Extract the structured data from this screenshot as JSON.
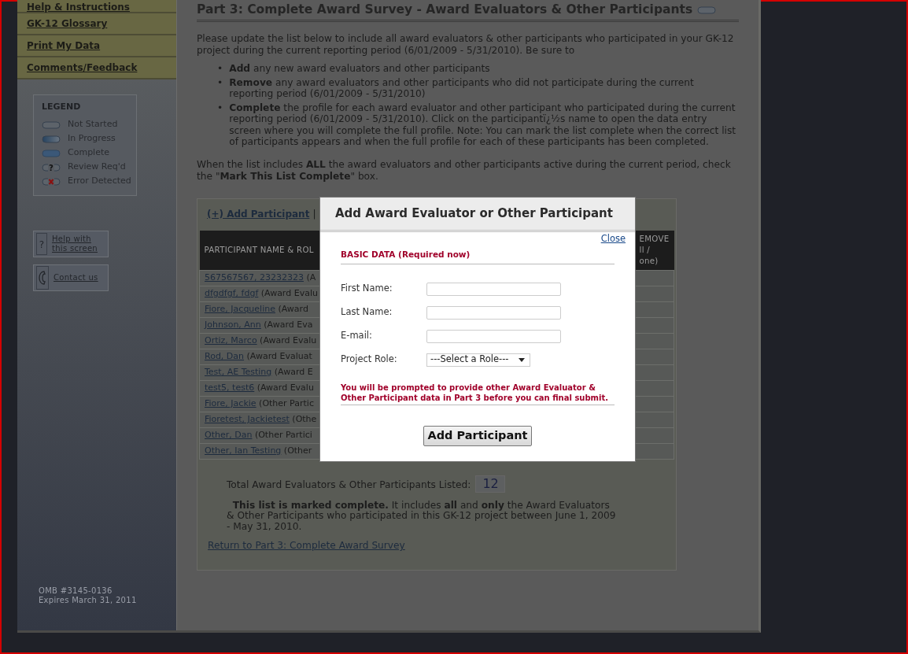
{
  "sidebar": {
    "nav_items": [
      "Help & Instructions",
      "GK-12 Glossary",
      "Print My Data",
      "Comments/Feedback"
    ],
    "legend": {
      "title": "LEGEND",
      "items": [
        {
          "kind": "not_started",
          "label": "Not Started"
        },
        {
          "kind": "in_progress",
          "label": "In Progress"
        },
        {
          "kind": "complete",
          "label": "Complete"
        },
        {
          "kind": "review",
          "label": "Review Req'd",
          "symbol": "?"
        },
        {
          "kind": "error",
          "label": "Error Detected"
        }
      ]
    },
    "help_buttons": [
      {
        "kind": "help",
        "label": "Help with this screen",
        "symbol": "?"
      },
      {
        "kind": "contact",
        "label": "Contact us"
      }
    ],
    "footer": [
      "OMB #3145-0136",
      "Expires March 31, 2011"
    ]
  },
  "page": {
    "title": "Part 3: Complete Award Survey - Award Evaluators & Other Participants",
    "intro": "Please update the list below to include all award evaluators & other participants who participated in your GK-12 project during the current reporting period (6/01/2009 - 5/31/2010). Be sure to",
    "bullets": [
      {
        "marker": "•",
        "text": "**Add** any new award evaluators and other participants"
      },
      {
        "marker": "•",
        "text": "**Remove** any award evaluators and other participants who did not participate during the current reporting period (6/01/2009 - 5/31/2010)"
      },
      {
        "marker": "•",
        "text": "**Complete** the profile for each award evaluator and other participant who participated during the current reporting period (6/01/2009 - 5/31/2010). Click on the participantï¿½s name to open the data entry screen where you will complete the full profile. Note: You can mark the list complete when the correct list of participants appears and when the full profile for each of these participants has been completed."
      }
    ],
    "instruction": "When the list includes **ALL** the award evaluators and other participants active during the current period, check the \"**Mark This List Complete**\" box.",
    "add_link": "(+) Add Participant",
    "separator": "|",
    "table": {
      "columns": [
        {
          "lines": [
            "PARTICIPANT NAME & ROL"
          ]
        },
        {
          "lines": [
            "EMOVE",
            "ll /",
            "one)"
          ]
        }
      ],
      "rows": [
        {
          "name": "567567567, 23232323",
          "role": "(A"
        },
        {
          "name": "dfgdfgf, fdgf",
          "role": "(Award Evalu"
        },
        {
          "name": "Fiore, Jacqueline",
          "role": "(Award"
        },
        {
          "name": "Johnson, Ann",
          "role": "(Award Eva"
        },
        {
          "name": "Ortiz, Marco",
          "role": "(Award Evalu"
        },
        {
          "name": "Rod, Dan",
          "role": "(Award Evaluat"
        },
        {
          "name": "Test, AE Testing",
          "role": "(Award E"
        },
        {
          "name": "test5, test6",
          "role": "(Award Evalu"
        },
        {
          "name": "Fiore, Jackie",
          "role": "(Other Partic"
        },
        {
          "name": "Fioretest, Jackietest",
          "role": "(Othe"
        },
        {
          "name": "Other, Dan",
          "role": "(Other Partici"
        },
        {
          "name": "Other, Ian Testing",
          "role": "(Other"
        }
      ]
    },
    "total_label": "Total Award Evaluators & Other Participants Listed:",
    "total_value": "12",
    "complete_statement": "**This list is marked complete.** It includes **all** and **only** the Award Evaluators & Other Participants who participated in this GK-12 project between June 1, 2009 - May 31, 2010.",
    "return_link": "Return to Part 3: Complete Award Survey"
  },
  "modal": {
    "title": "Add Award Evaluator or Other Participant",
    "close": "Close",
    "section": "BASIC DATA (Required now)",
    "fields": [
      {
        "kind": "text",
        "label": "First Name:"
      },
      {
        "kind": "text",
        "label": "Last Name:"
      },
      {
        "kind": "text",
        "label": "E-mail:"
      },
      {
        "kind": "select",
        "label": "Project Role:",
        "value": "---Select a Role---"
      }
    ],
    "note": "You will be prompted to provide other Award Evaluator & Other Participant data in Part 3 before you can final submit.",
    "button": "Add Participant"
  }
}
